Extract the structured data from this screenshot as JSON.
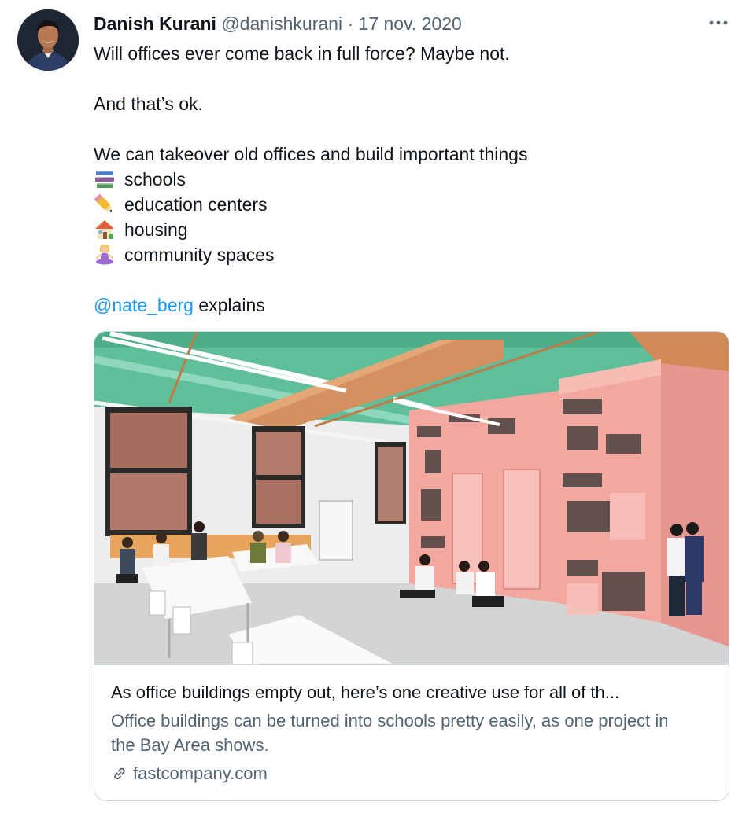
{
  "tweet": {
    "author": {
      "display_name": "Danish Kurani",
      "handle": "@danishkurani"
    },
    "separator": "·",
    "date": "17 nov. 2020",
    "text": {
      "line1": "Will offices ever come back in full force? Maybe not.",
      "line2": "And that’s ok.",
      "line3": "We can takeover old offices and build important things",
      "list": [
        {
          "icon": "books-emoji",
          "label": "schools"
        },
        {
          "icon": "pencil-emoji",
          "label": "education centers"
        },
        {
          "icon": "house-emoji",
          "label": "housing"
        },
        {
          "icon": "person-lotus-emoji",
          "label": "community spaces"
        }
      ],
      "mention": "@nate_berg",
      "mention_suffix": " explains"
    }
  },
  "card": {
    "title": "As office buildings empty out, here’s one creative use for all of th...",
    "description": "Office buildings can be turned into schools pretty easily, as one project in the Bay Area shows.",
    "domain": "fastcompany.com",
    "domain_icon": "link-icon"
  },
  "colors": {
    "text": "#0f1419",
    "secondary": "#536471",
    "link": "#1d9bf0",
    "border": "#cfd9de"
  }
}
